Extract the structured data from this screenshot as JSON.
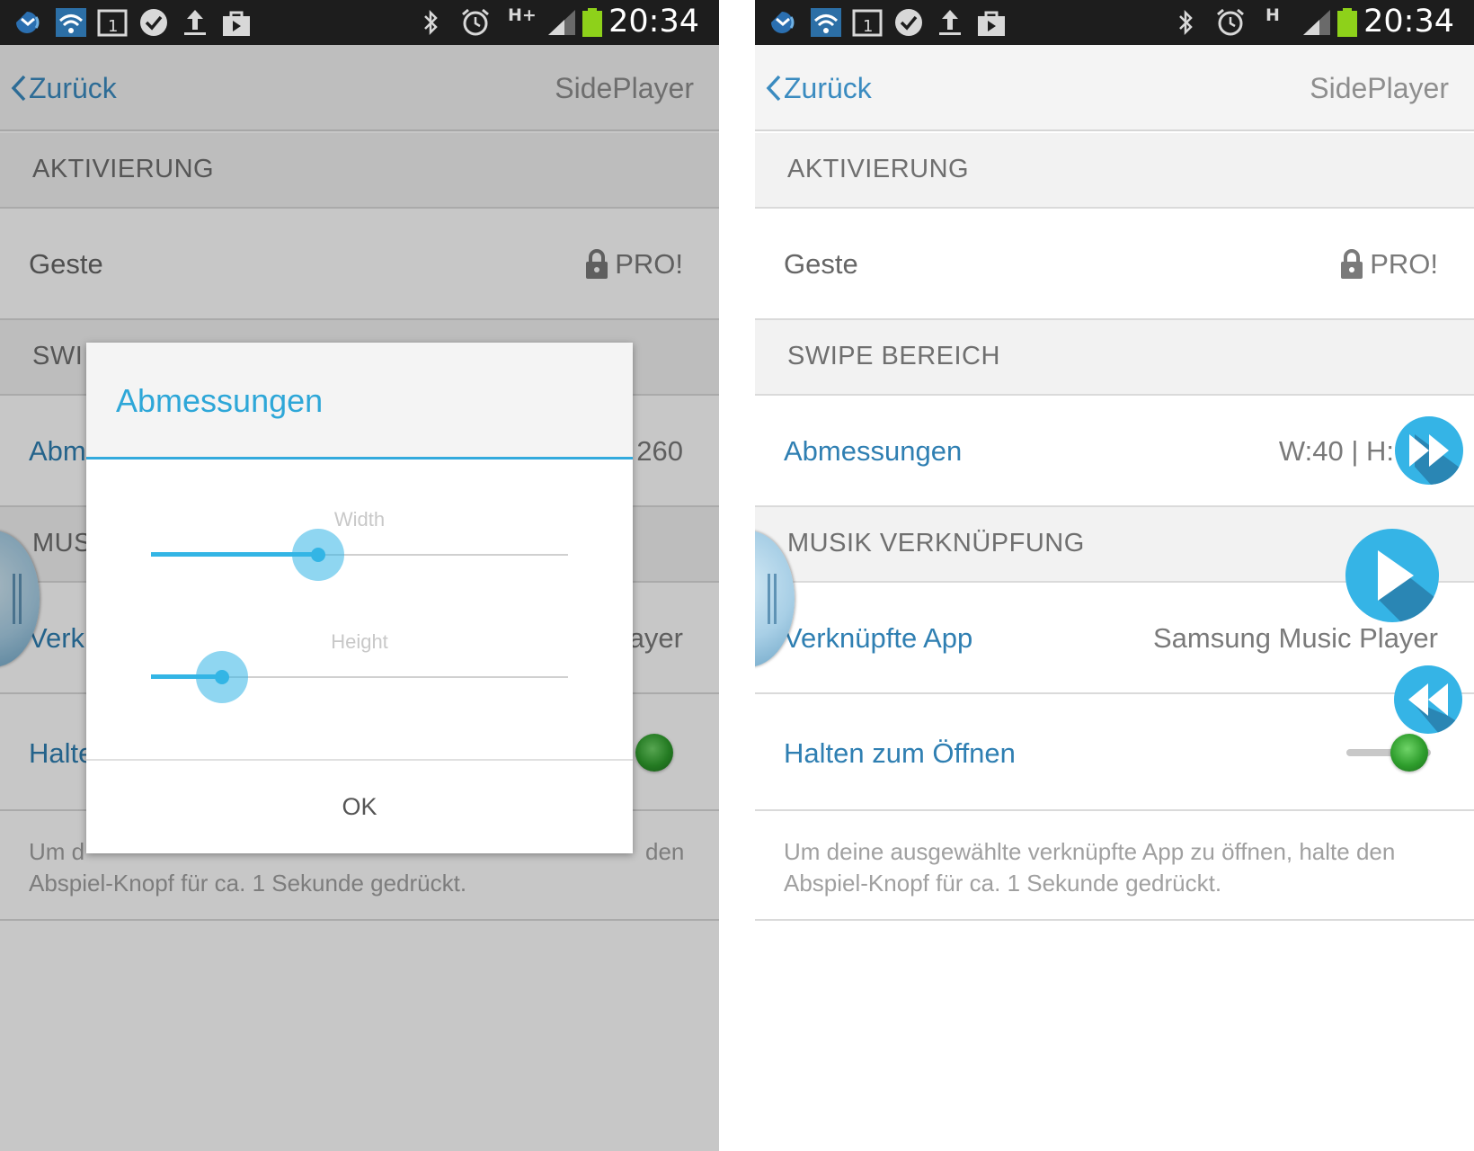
{
  "status_bar": {
    "time": "20:34",
    "network_left": "H+",
    "network_right": "H"
  },
  "action_bar": {
    "back_label": "Zurück",
    "app_title": "SidePlayer"
  },
  "sections": {
    "activation": "AKTIVIERUNG",
    "swipe_area": "SWIPE BEREICH",
    "music_link": "MUSIK VERKNÜPFUNG"
  },
  "items": {
    "gesture": {
      "label": "Geste",
      "value": "PRO!"
    },
    "dimensions": {
      "label": "Abmessungen",
      "value_right": "W:40 | H:",
      "value_left_visible": "260"
    },
    "linked_app": {
      "label": "Verknüpfte App",
      "value": "Samsung Music Player"
    },
    "hold_to_open": {
      "label": "Halten zum Öffnen",
      "toggle_on": true
    }
  },
  "note": "Um deine ausgewählte verknüpfte App zu öffnen, halte den Abspiel-Knopf für ca. 1 Sekunde gedrückt.",
  "dialog": {
    "title": "Abmessungen",
    "width_label": "Width",
    "height_label": "Height",
    "width_value": 0.4,
    "height_value": 0.17,
    "ok_label": "OK"
  },
  "partials_left": {
    "swipe_section": "SWI",
    "dimensions": "Abm",
    "music_section": "MUS",
    "linked_app": "Verk",
    "linked_app_value": "ayer",
    "hold_to_open": "Halte",
    "note_line1_start": "Um d",
    "note_line1_end": "den",
    "note_line2": "Abspiel-Knopf für ca. 1 Sekunde gedrückt."
  },
  "colors": {
    "accent_blue": "#33b5e5",
    "link_blue": "#2f7fb2",
    "status_bar_bg": "#1d1d1d",
    "battery_green": "#8ed11a",
    "toggle_green": "#2e9d2c"
  },
  "icons": [
    "mail-notification-icon",
    "wifi-notification-icon",
    "calendar-icon",
    "check-icon",
    "upload-icon",
    "store-icon",
    "bluetooth-icon",
    "alarm-icon",
    "signal-icon",
    "battery-icon",
    "chevron-left-icon",
    "lock-icon",
    "fast-forward-icon",
    "play-icon",
    "rewind-icon",
    "drag-handle-icon"
  ]
}
